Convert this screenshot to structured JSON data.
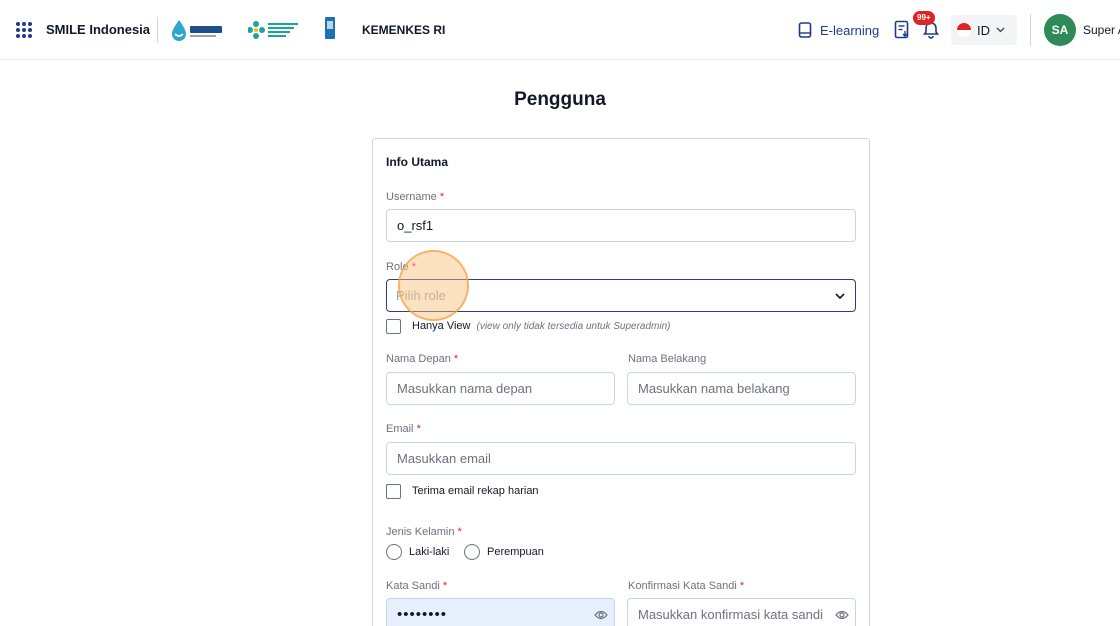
{
  "header": {
    "app_name": "SMILE Indonesia",
    "org_name": "KEMENKES RI",
    "elearning_label": "E-learning",
    "notification_count": "99+",
    "language": "ID",
    "avatar_initials": "SA",
    "user_name": "Super A",
    "logos": [
      "smile-logo",
      "kemenkes-logo",
      "undp-logo"
    ]
  },
  "page": {
    "title": "Pengguna"
  },
  "form": {
    "section_title": "Info Utama",
    "required_mark": "*",
    "username": {
      "label": "Username",
      "value": "o_rsf1"
    },
    "role": {
      "label": "Role",
      "placeholder": "Pilih role"
    },
    "view_only": {
      "label": "Hanya View",
      "note": "(view only tidak tersedia untuk Superadmin)",
      "checked": false
    },
    "first_name": {
      "label": "Nama Depan",
      "placeholder": "Masukkan nama depan"
    },
    "last_name": {
      "label": "Nama Belakang",
      "placeholder": "Masukkan nama belakang"
    },
    "email": {
      "label": "Email",
      "placeholder": "Masukkan email"
    },
    "daily_recap": {
      "label": "Terima email rekap harian",
      "checked": false
    },
    "gender": {
      "label": "Jenis Kelamin",
      "options": [
        "Laki-laki",
        "Perempuan"
      ]
    },
    "password": {
      "label": "Kata Sandi",
      "masked_value": "••••••••"
    },
    "confirm_password": {
      "label": "Konfirmasi Kata Sandi",
      "placeholder": "Masukkan konfirmasi kata sandi"
    }
  },
  "colors": {
    "brand_navy": "#1e3a8a",
    "focus_border": "#2c3e8a",
    "required": "#dc2626",
    "avatar_bg": "#2e8b57",
    "badge_bg": "#dc2626",
    "password_fill_bg": "#e8effc",
    "click_ring": "#f59e42"
  }
}
